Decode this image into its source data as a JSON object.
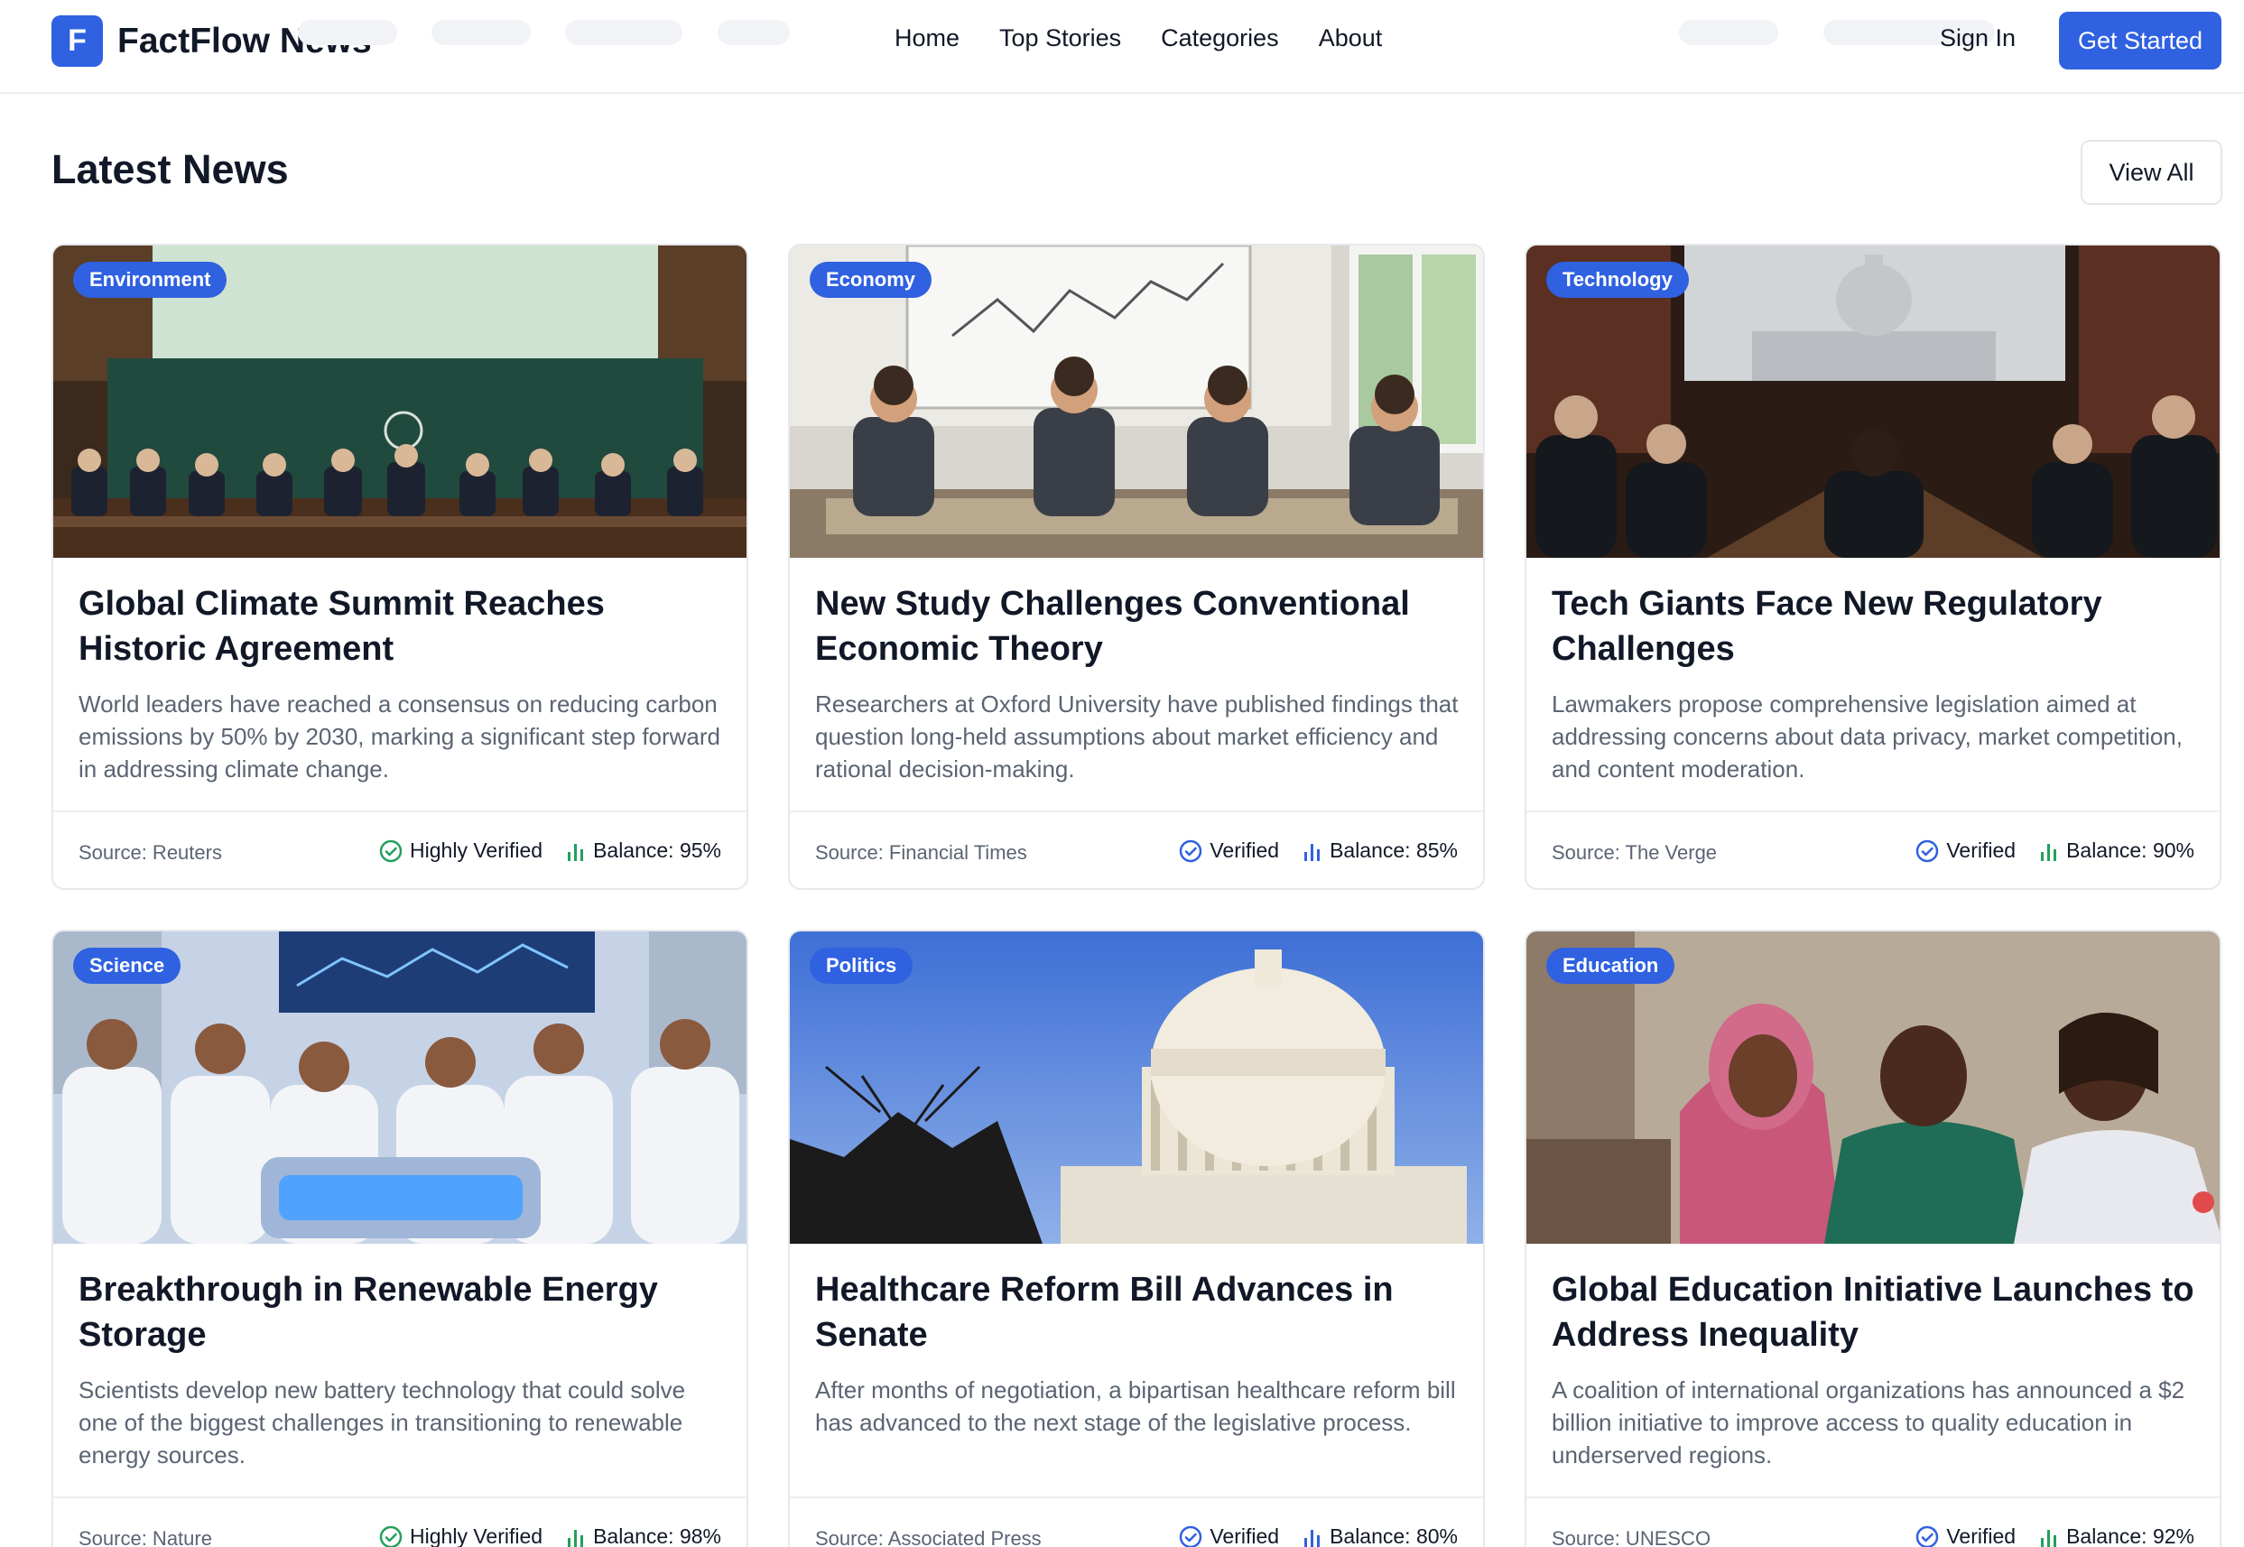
{
  "brand": {
    "initial": "F",
    "name": "FactFlow News"
  },
  "nav": {
    "links": [
      "Home",
      "Top Stories",
      "Categories",
      "About"
    ],
    "sign_in": "Sign In",
    "get_started": "Get Started"
  },
  "section": {
    "title": "Latest News",
    "view_all": "View All"
  },
  "colors": {
    "accent": "#2f61e0",
    "text": "#111827",
    "muted": "#5b6473",
    "verified_green": "#22a05b",
    "verified_blue": "#2f61e0"
  },
  "articles": [
    {
      "category": "Environment",
      "title": "Global Climate Summit Reaches Historic Agreement",
      "description": "World leaders have reached a consensus on reducing carbon emissions by 50% by 2030, marking a significant step forward in addressing climate change.",
      "source": "Source: Reuters",
      "verification": "Highly Verified",
      "verification_icon": "check-circle-green-icon",
      "balance": "Balance: 95%",
      "balance_icon": "bar-chart-green-icon"
    },
    {
      "category": "Economy",
      "title": "New Study Challenges Conventional Economic Theory",
      "description": "Researchers at Oxford University have published findings that question long-held assumptions about market efficiency and rational decision-making.",
      "source": "Source: Financial Times",
      "verification": "Verified",
      "verification_icon": "check-circle-blue-icon",
      "balance": "Balance: 85%",
      "balance_icon": "bar-chart-blue-icon"
    },
    {
      "category": "Technology",
      "title": "Tech Giants Face New Regulatory Challenges",
      "description": "Lawmakers propose comprehensive legislation aimed at addressing concerns about data privacy, market competition, and content moderation.",
      "source": "Source: The Verge",
      "verification": "Verified",
      "verification_icon": "check-circle-blue-icon",
      "balance": "Balance: 90%",
      "balance_icon": "bar-chart-green-icon"
    },
    {
      "category": "Science",
      "title": "Breakthrough in Renewable Energy Storage",
      "description": "Scientists develop new battery technology that could solve one of the biggest challenges in transitioning to renewable energy sources.",
      "source": "Source: Nature",
      "verification": "Highly Verified",
      "verification_icon": "check-circle-green-icon",
      "balance": "Balance: 98%",
      "balance_icon": "bar-chart-green-icon"
    },
    {
      "category": "Politics",
      "title": "Healthcare Reform Bill Advances in Senate",
      "description": "After months of negotiation, a bipartisan healthcare reform bill has advanced to the next stage of the legislative process.",
      "source": "Source: Associated Press",
      "verification": "Verified",
      "verification_icon": "check-circle-blue-icon",
      "balance": "Balance: 80%",
      "balance_icon": "bar-chart-blue-icon"
    },
    {
      "category": "Education",
      "title": "Global Education Initiative Launches to Address Inequality",
      "description": "A coalition of international organizations has announced a $2 billion initiative to improve access to quality education in underserved regions.",
      "source": "Source: UNESCO",
      "verification": "Verified",
      "verification_icon": "check-circle-blue-icon",
      "balance": "Balance: 92%",
      "balance_icon": "bar-chart-green-icon"
    }
  ]
}
